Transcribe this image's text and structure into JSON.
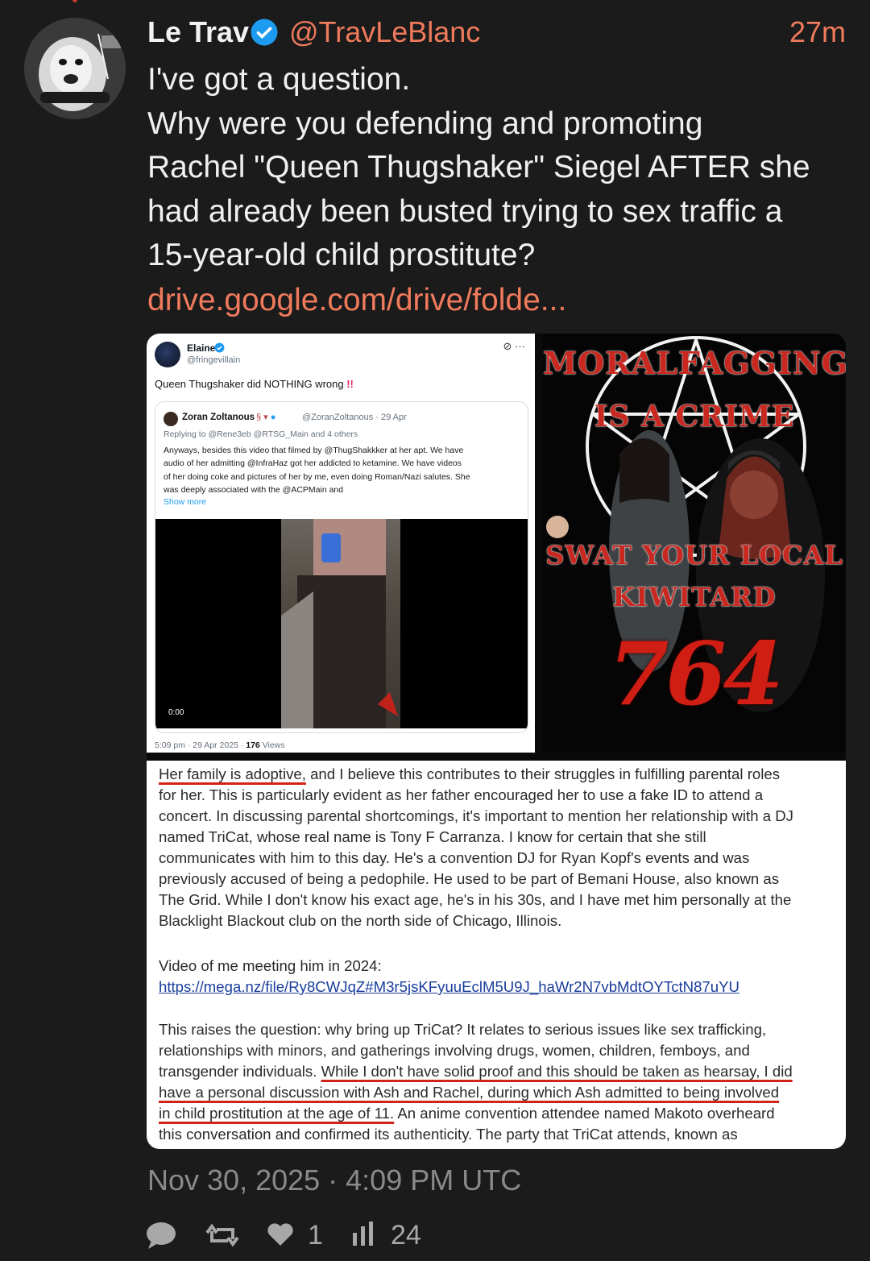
{
  "tweet": {
    "author_name": "Le Trav",
    "handle": "@TravLeBlanc",
    "time_ago": "27m",
    "text_lines": [
      "I've got a question.",
      "Why were you defending and promoting",
      "Rachel \"Queen Thugshaker\" Siegel AFTER she",
      "had already been busted trying to sex traffic a",
      "15-year-old child prostitute?"
    ],
    "link": "drive.google.com/drive/folde...",
    "posted_at": "Nov 30, 2025 · 4:09 PM UTC",
    "likes": "1",
    "views": "24",
    "accent_color": "#ef7a5c"
  },
  "embedded_tweet": {
    "name": "Elaine",
    "handle": "@fringevillain",
    "text": "Queen Thugshaker did NOTHING wrong",
    "emphasis": "!!",
    "quote": {
      "name": "Zoran Zoltanous",
      "handle_date": "@ZoranZoltanous · 29 Apr",
      "replying": "Replying to @Rene3eb @RTSG_Main  and 4 others",
      "body_lines": [
        "Anyways, besides this video that filmed by @ThugShakkker at her apt. We have",
        "audio of her admitting @InfraHaz got her addicted to ketamine. We have videos",
        "of her doing coke and pictures of her by me, even doing Roman/Nazi salutes. She",
        "was deeply associated with the @ACPMain  and"
      ],
      "show_more": "Show more",
      "video_time": "0:00"
    },
    "stats_time": "5:09 pm · 29 Apr 2025 · ",
    "stats_views": "176",
    "stats_label": " Views"
  },
  "poster": {
    "line1": "MORALFAGGING",
    "line2": "IS A CRIME",
    "line3": "SWAT YOUR LOCAL",
    "line4": "KIWITARD",
    "number": "764"
  },
  "document": {
    "p1_underlined": "Her family is adoptive,",
    "p1_rest": " and I believe this contributes to their struggles in fulfilling parental roles",
    "lines_a": [
      "for her. This is particularly evident as her father encouraged her to use a fake ID to attend a",
      "concert. In discussing parental shortcomings, it's important to mention her relationship with a DJ",
      "named TriCat, whose real name is Tony F Carranza. I know for certain that she still",
      "communicates with him to this day. He's a convention DJ for Ryan Kopf's events and was",
      "previously accused of being a pedophile. He used to be part of Bemani House, also known as",
      "The Grid. While I don't know his exact age, he's in his 30s, and I have met him personally at the",
      "Blacklight Blackout club on the north side of Chicago, Illinois."
    ],
    "video_label": "Video of me meeting him in 2024:",
    "video_url": "https://mega.nz/file/Ry8CWJqZ#M3r5jsKFyuuEclM5U9J_haWr2N7vbMdtOYTctN87uYU",
    "p3_lines": [
      "This raises the question: why bring up TriCat? It relates to serious issues like sex trafficking,",
      "relationships with minors, and gatherings involving drugs, women, children, femboys, and"
    ],
    "p3_line3_plain": "transgender individuals. ",
    "p3_line3_ul": "While I don't have solid proof and this should be taken as hearsay, I did",
    "p3_line4_ul": "have a personal discussion with Ash and Rachel, during which Ash admitted to being involved",
    "p3_line5_ul": "in child prostitution at the age of 11.",
    "p3_line5_rest": " An anime convention attendee named Makoto overheard",
    "p3_line6": "this conversation and confirmed its authenticity. The party that TriCat attends, known as"
  }
}
